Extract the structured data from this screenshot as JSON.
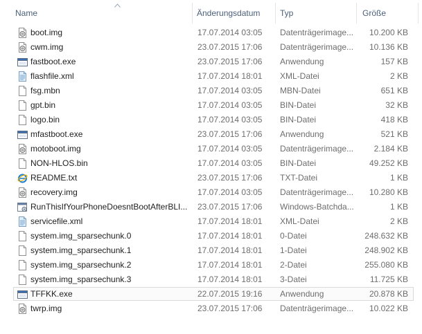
{
  "columns": {
    "name": "Name",
    "date": "Änderungsdatum",
    "type": "Typ",
    "size": "Größe"
  },
  "sort": {
    "column": "name",
    "direction": "ascending"
  },
  "files": [
    {
      "name": "boot.img",
      "date": "17.07.2014 03:05",
      "type": "Datenträgerimage...",
      "size": "10.200 KB",
      "icon": "disc-image-icon"
    },
    {
      "name": "cwm.img",
      "date": "23.07.2015 17:06",
      "type": "Datenträgerimage...",
      "size": "10.136 KB",
      "icon": "disc-image-icon"
    },
    {
      "name": "fastboot.exe",
      "date": "23.07.2015 17:06",
      "type": "Anwendung",
      "size": "157 KB",
      "icon": "application-icon"
    },
    {
      "name": "flashfile.xml",
      "date": "17.07.2014 18:01",
      "type": "XML-Datei",
      "size": "2 KB",
      "icon": "xml-file-icon"
    },
    {
      "name": "fsg.mbn",
      "date": "17.07.2014 03:05",
      "type": "MBN-Datei",
      "size": "651 KB",
      "icon": "file-icon"
    },
    {
      "name": "gpt.bin",
      "date": "17.07.2014 03:05",
      "type": "BIN-Datei",
      "size": "32 KB",
      "icon": "file-icon"
    },
    {
      "name": "logo.bin",
      "date": "17.07.2014 03:05",
      "type": "BIN-Datei",
      "size": "418 KB",
      "icon": "file-icon"
    },
    {
      "name": "mfastboot.exe",
      "date": "23.07.2015 17:06",
      "type": "Anwendung",
      "size": "521 KB",
      "icon": "application-icon"
    },
    {
      "name": "motoboot.img",
      "date": "17.07.2014 03:05",
      "type": "Datenträgerimage...",
      "size": "2.184 KB",
      "icon": "disc-image-icon"
    },
    {
      "name": "NON-HLOS.bin",
      "date": "17.07.2014 03:05",
      "type": "BIN-Datei",
      "size": "49.252 KB",
      "icon": "file-icon"
    },
    {
      "name": "README.txt",
      "date": "23.07.2015 17:06",
      "type": "TXT-Datei",
      "size": "1 KB",
      "icon": "internet-explorer-icon"
    },
    {
      "name": "recovery.img",
      "date": "17.07.2014 03:05",
      "type": "Datenträgerimage...",
      "size": "10.280 KB",
      "icon": "disc-image-icon"
    },
    {
      "name": "RunThisIfYourPhoneDoesntBootAfterBLI...",
      "date": "23.07.2015 17:06",
      "type": "Windows-Batchda...",
      "size": "1 KB",
      "icon": "batch-file-icon"
    },
    {
      "name": "servicefile.xml",
      "date": "17.07.2014 18:01",
      "type": "XML-Datei",
      "size": "2 KB",
      "icon": "xml-file-icon"
    },
    {
      "name": "system.img_sparsechunk.0",
      "date": "17.07.2014 18:01",
      "type": "0-Datei",
      "size": "248.632 KB",
      "icon": "file-icon"
    },
    {
      "name": "system.img_sparsechunk.1",
      "date": "17.07.2014 18:01",
      "type": "1-Datei",
      "size": "248.902 KB",
      "icon": "file-icon"
    },
    {
      "name": "system.img_sparsechunk.2",
      "date": "17.07.2014 18:01",
      "type": "2-Datei",
      "size": "255.080 KB",
      "icon": "file-icon"
    },
    {
      "name": "system.img_sparsechunk.3",
      "date": "17.07.2014 18:01",
      "type": "3-Datei",
      "size": "11.725 KB",
      "icon": "file-icon"
    },
    {
      "name": "TFFKK.exe",
      "date": "22.07.2015 19:16",
      "type": "Anwendung",
      "size": "20.878 KB",
      "icon": "application-icon",
      "selected": true
    },
    {
      "name": "twrp.img",
      "date": "23.07.2015 17:06",
      "type": "Datenträgerimage...",
      "size": "10.022 KB",
      "icon": "disc-image-icon"
    }
  ]
}
